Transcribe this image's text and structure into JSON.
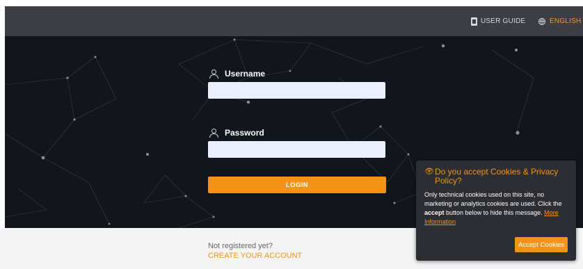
{
  "header": {
    "user_guide_label": "USER GUIDE",
    "language_label": "ENGLISH",
    "user_guide_icon": "document-icon",
    "language_icon": "globe-icon"
  },
  "login": {
    "username_label": "Username",
    "username_value": "",
    "password_label": "Password",
    "password_value": "",
    "login_button": "LOGIN"
  },
  "footer": {
    "not_registered": "Not registered yet?",
    "create_account": "CREATE YOUR ACCOUNT"
  },
  "cookie": {
    "title": "Do you accept Cookies & Privacy Policy?",
    "text_before": "Only technical cookies used on this site, no marketing or analytics cookies are used. Click the ",
    "text_accept": "accept",
    "text_after": " button below to hide this message. ",
    "more_info": "More Information",
    "accept_button": "Accept Cookies"
  },
  "colors": {
    "accent": "#f39419",
    "header_bg": "#3c3e44",
    "hero_bg": "#12151b"
  }
}
